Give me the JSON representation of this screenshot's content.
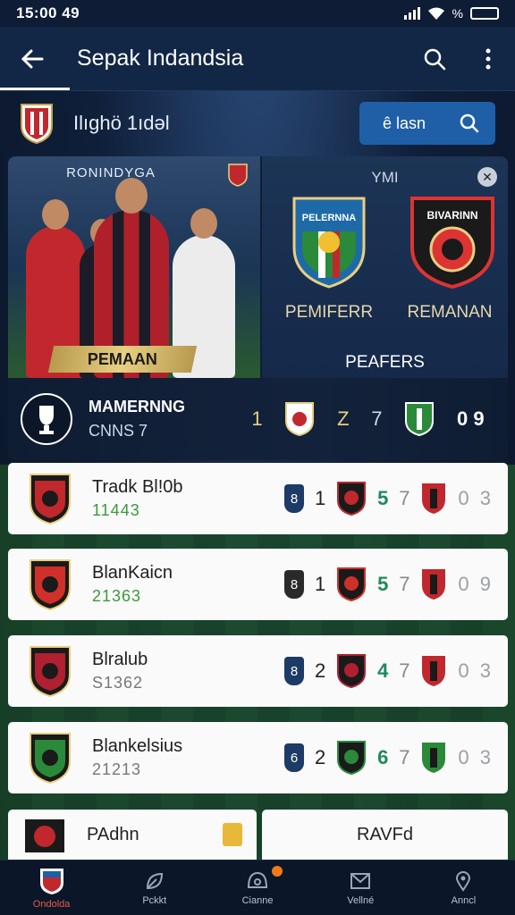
{
  "status": {
    "time": "15:00 49",
    "percent": "%"
  },
  "app_bar": {
    "title": "Sepak Indandsia"
  },
  "league_row": {
    "name": "Ilıghö 1ıdəl",
    "search_label": "ê lasn"
  },
  "hero": {
    "left_label": "RONINDYGA",
    "banner": "PEMAAN",
    "vs_label": "YMI",
    "info": "✕",
    "club_a": "PEMIFERR",
    "club_b": "REMANAN",
    "crest_a_text": "PELERNNA",
    "crest_b_text": "BIVARINN",
    "preferences": "PEAFERS",
    "bottom_title": "MAMERNNG",
    "bottom_sub": "CNNS 7",
    "stat_1": "1",
    "stat_2": "Z",
    "stat_3": "7",
    "stat_4": "0 9"
  },
  "rows": [
    {
      "name": "Tradk Bl!0b",
      "sub": "11443",
      "pill": "8",
      "a": "1",
      "b": "5",
      "c": "7",
      "score": "0 3",
      "accent": "#c0282d"
    },
    {
      "name": "BlanKaicn",
      "sub": "21363",
      "pill": "8",
      "a": "1",
      "b": "5",
      "c": "7",
      "score": "0 9",
      "accent": "#d0302a"
    },
    {
      "name": "Blralub",
      "sub": "S1362",
      "pill": "8",
      "a": "2",
      "b": "4",
      "c": "7",
      "score": "0 3",
      "accent": "#b02030"
    },
    {
      "name": "Blankelsius",
      "sub": "21213",
      "pill": "6",
      "a": "2",
      "b": "6",
      "c": "7",
      "score": "0 3",
      "accent": "#2a8a3a"
    }
  ],
  "last_row": {
    "name": "PAdhn",
    "right_label": "RAVFd"
  },
  "nav": [
    {
      "label": "Ondolda",
      "icon": "crest-icon"
    },
    {
      "label": "Pckkt",
      "icon": "leaf-icon"
    },
    {
      "label": "Cianne",
      "icon": "helmet-icon"
    },
    {
      "label": "Vellné",
      "icon": "mail-icon"
    },
    {
      "label": "Anncl",
      "icon": "pin-icon"
    }
  ],
  "colors": {
    "accent": "#1f5fa8",
    "gold": "#e8cf82",
    "green": "#1e8a5a"
  }
}
